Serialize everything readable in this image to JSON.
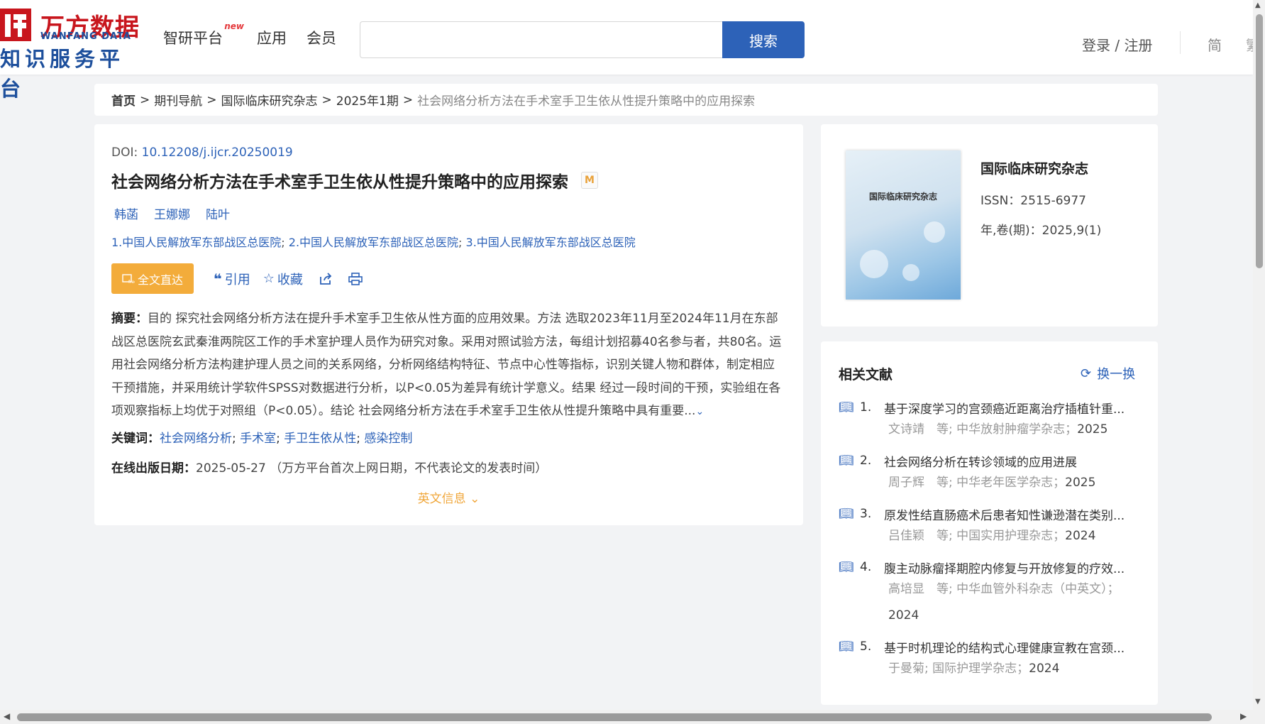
{
  "header": {
    "logo_cn": "万方数据",
    "logo_en": "WANFANG DATA",
    "logo_sub": "知识服务平台",
    "nav": [
      {
        "label": "智研平台",
        "badge": "new"
      },
      {
        "label": "应用"
      },
      {
        "label": "会员"
      }
    ],
    "search_placeholder": "",
    "search_button": "搜索",
    "login": "登录 / 注册",
    "lang_simplified": "简",
    "lang_traditional": "繁"
  },
  "breadcrumb": [
    "首页",
    "期刊导航",
    "国际临床研究杂志",
    "2025年1期",
    "社会网络分析方法在手术室手卫生依从性提升策略中的应用探索"
  ],
  "article": {
    "doi_label": "DOI:",
    "doi": "10.12208/j.ijcr.20250019",
    "title": "社会网络分析方法在手术室手卫生依从性提升策略中的应用探索",
    "badge": "M",
    "authors": [
      "韩菡",
      "王娜娜",
      "陆叶"
    ],
    "affiliations": [
      "1.中国人民解放军东部战区总医院",
      "2.中国人民解放军东部战区总医院",
      "3.中国人民解放军东部战区总医院"
    ],
    "fulltext_button": "全文直达",
    "actions": {
      "cite": "引用",
      "favorite": "收藏"
    },
    "abstract_label": "摘要：",
    "abstract": "目的 探究社会网络分析方法在提升手术室手卫生依从性方面的应用效果。方法 选取2023年11月至2024年11月在东部战区总医院玄武秦淮两院区工作的手术室护理人员作为研究对象。采用对照试验方法，每组计划招募40名参与者，共80名。运用社会网络分析方法构建护理人员之间的关系网络，分析网络结构特征、节点中心性等指标，识别关键人物和群体，制定相应干预措施，并采用统计学软件SPSS对数据进行分析，以P<0.05为差异有统计学意义。结果 经过一段时间的干预，实验组在各项观察指标上均优于对照组（P<0.05）。结论 社会网络分析方法在手术室手卫生依从性提升策略中具有重要...",
    "keywords_label": "关键词：",
    "keywords": [
      "社会网络分析",
      "手术室",
      "手卫生依从性",
      "感染控制"
    ],
    "pubdate_label": "在线出版日期：",
    "pubdate": "2025-05-27",
    "pubdate_note": "（万方平台首次上网日期，不代表论文的发表时间）",
    "english_info": "英文信息"
  },
  "journal": {
    "cover_title": "国际临床研究杂志",
    "name": "国际临床研究杂志",
    "issn": "ISSN：2515-6977",
    "volume": "年,卷(期)：2025,9(1)"
  },
  "related": {
    "heading": "相关文献",
    "refresh": "换一换",
    "items": [
      {
        "num": "1.",
        "title": "基于深度学习的宫颈癌近距离治疗插植针重...",
        "authors": "文诗靖　等;",
        "journal": "中华放射肿瘤学杂志；",
        "year": "2025"
      },
      {
        "num": "2.",
        "title": "社会网络分析在转诊领域的应用进展",
        "authors": "周子辉　等;",
        "journal": "中华老年医学杂志；",
        "year": "2025"
      },
      {
        "num": "3.",
        "title": "原发性结直肠癌术后患者知性谦逊潜在类别...",
        "authors": "吕佳颖　等;",
        "journal": "中国实用护理杂志；",
        "year": "2024"
      },
      {
        "num": "4.",
        "title": "腹主动脉瘤择期腔内修复与开放修复的疗效...",
        "authors": "高培显　等;",
        "journal": "中华血管外科杂志（中英文）；",
        "year": "2024"
      },
      {
        "num": "5.",
        "title": "基于时机理论的结构式心理健康宣教在宫颈...",
        "authors": "于曼菊;",
        "journal": "国际护理学杂志；",
        "year": "2024"
      }
    ]
  }
}
